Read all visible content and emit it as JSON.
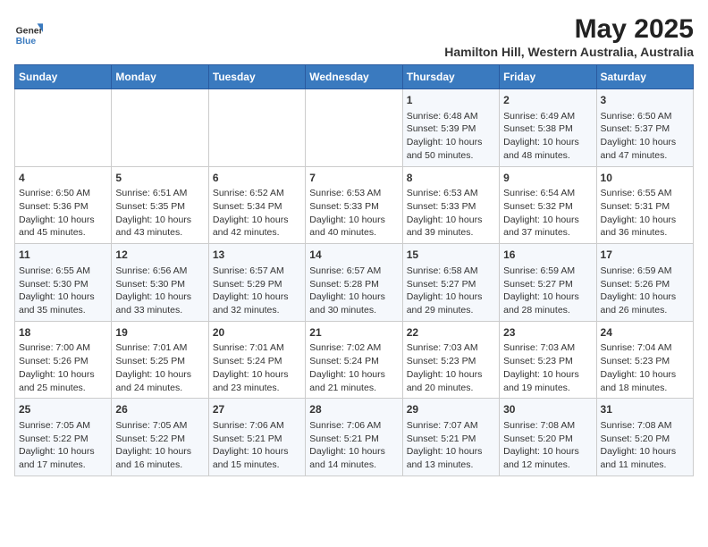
{
  "logo": {
    "general": "General",
    "blue": "Blue"
  },
  "title": "May 2025",
  "subtitle": "Hamilton Hill, Western Australia, Australia",
  "headers": [
    "Sunday",
    "Monday",
    "Tuesday",
    "Wednesday",
    "Thursday",
    "Friday",
    "Saturday"
  ],
  "weeks": [
    [
      {
        "day": "",
        "content": ""
      },
      {
        "day": "",
        "content": ""
      },
      {
        "day": "",
        "content": ""
      },
      {
        "day": "",
        "content": ""
      },
      {
        "day": "1",
        "content": "Sunrise: 6:48 AM\nSunset: 5:39 PM\nDaylight: 10 hours and 50 minutes."
      },
      {
        "day": "2",
        "content": "Sunrise: 6:49 AM\nSunset: 5:38 PM\nDaylight: 10 hours and 48 minutes."
      },
      {
        "day": "3",
        "content": "Sunrise: 6:50 AM\nSunset: 5:37 PM\nDaylight: 10 hours and 47 minutes."
      }
    ],
    [
      {
        "day": "4",
        "content": "Sunrise: 6:50 AM\nSunset: 5:36 PM\nDaylight: 10 hours and 45 minutes."
      },
      {
        "day": "5",
        "content": "Sunrise: 6:51 AM\nSunset: 5:35 PM\nDaylight: 10 hours and 43 minutes."
      },
      {
        "day": "6",
        "content": "Sunrise: 6:52 AM\nSunset: 5:34 PM\nDaylight: 10 hours and 42 minutes."
      },
      {
        "day": "7",
        "content": "Sunrise: 6:53 AM\nSunset: 5:33 PM\nDaylight: 10 hours and 40 minutes."
      },
      {
        "day": "8",
        "content": "Sunrise: 6:53 AM\nSunset: 5:33 PM\nDaylight: 10 hours and 39 minutes."
      },
      {
        "day": "9",
        "content": "Sunrise: 6:54 AM\nSunset: 5:32 PM\nDaylight: 10 hours and 37 minutes."
      },
      {
        "day": "10",
        "content": "Sunrise: 6:55 AM\nSunset: 5:31 PM\nDaylight: 10 hours and 36 minutes."
      }
    ],
    [
      {
        "day": "11",
        "content": "Sunrise: 6:55 AM\nSunset: 5:30 PM\nDaylight: 10 hours and 35 minutes."
      },
      {
        "day": "12",
        "content": "Sunrise: 6:56 AM\nSunset: 5:30 PM\nDaylight: 10 hours and 33 minutes."
      },
      {
        "day": "13",
        "content": "Sunrise: 6:57 AM\nSunset: 5:29 PM\nDaylight: 10 hours and 32 minutes."
      },
      {
        "day": "14",
        "content": "Sunrise: 6:57 AM\nSunset: 5:28 PM\nDaylight: 10 hours and 30 minutes."
      },
      {
        "day": "15",
        "content": "Sunrise: 6:58 AM\nSunset: 5:27 PM\nDaylight: 10 hours and 29 minutes."
      },
      {
        "day": "16",
        "content": "Sunrise: 6:59 AM\nSunset: 5:27 PM\nDaylight: 10 hours and 28 minutes."
      },
      {
        "day": "17",
        "content": "Sunrise: 6:59 AM\nSunset: 5:26 PM\nDaylight: 10 hours and 26 minutes."
      }
    ],
    [
      {
        "day": "18",
        "content": "Sunrise: 7:00 AM\nSunset: 5:26 PM\nDaylight: 10 hours and 25 minutes."
      },
      {
        "day": "19",
        "content": "Sunrise: 7:01 AM\nSunset: 5:25 PM\nDaylight: 10 hours and 24 minutes."
      },
      {
        "day": "20",
        "content": "Sunrise: 7:01 AM\nSunset: 5:24 PM\nDaylight: 10 hours and 23 minutes."
      },
      {
        "day": "21",
        "content": "Sunrise: 7:02 AM\nSunset: 5:24 PM\nDaylight: 10 hours and 21 minutes."
      },
      {
        "day": "22",
        "content": "Sunrise: 7:03 AM\nSunset: 5:23 PM\nDaylight: 10 hours and 20 minutes."
      },
      {
        "day": "23",
        "content": "Sunrise: 7:03 AM\nSunset: 5:23 PM\nDaylight: 10 hours and 19 minutes."
      },
      {
        "day": "24",
        "content": "Sunrise: 7:04 AM\nSunset: 5:23 PM\nDaylight: 10 hours and 18 minutes."
      }
    ],
    [
      {
        "day": "25",
        "content": "Sunrise: 7:05 AM\nSunset: 5:22 PM\nDaylight: 10 hours and 17 minutes."
      },
      {
        "day": "26",
        "content": "Sunrise: 7:05 AM\nSunset: 5:22 PM\nDaylight: 10 hours and 16 minutes."
      },
      {
        "day": "27",
        "content": "Sunrise: 7:06 AM\nSunset: 5:21 PM\nDaylight: 10 hours and 15 minutes."
      },
      {
        "day": "28",
        "content": "Sunrise: 7:06 AM\nSunset: 5:21 PM\nDaylight: 10 hours and 14 minutes."
      },
      {
        "day": "29",
        "content": "Sunrise: 7:07 AM\nSunset: 5:21 PM\nDaylight: 10 hours and 13 minutes."
      },
      {
        "day": "30",
        "content": "Sunrise: 7:08 AM\nSunset: 5:20 PM\nDaylight: 10 hours and 12 minutes."
      },
      {
        "day": "31",
        "content": "Sunrise: 7:08 AM\nSunset: 5:20 PM\nDaylight: 10 hours and 11 minutes."
      }
    ]
  ]
}
